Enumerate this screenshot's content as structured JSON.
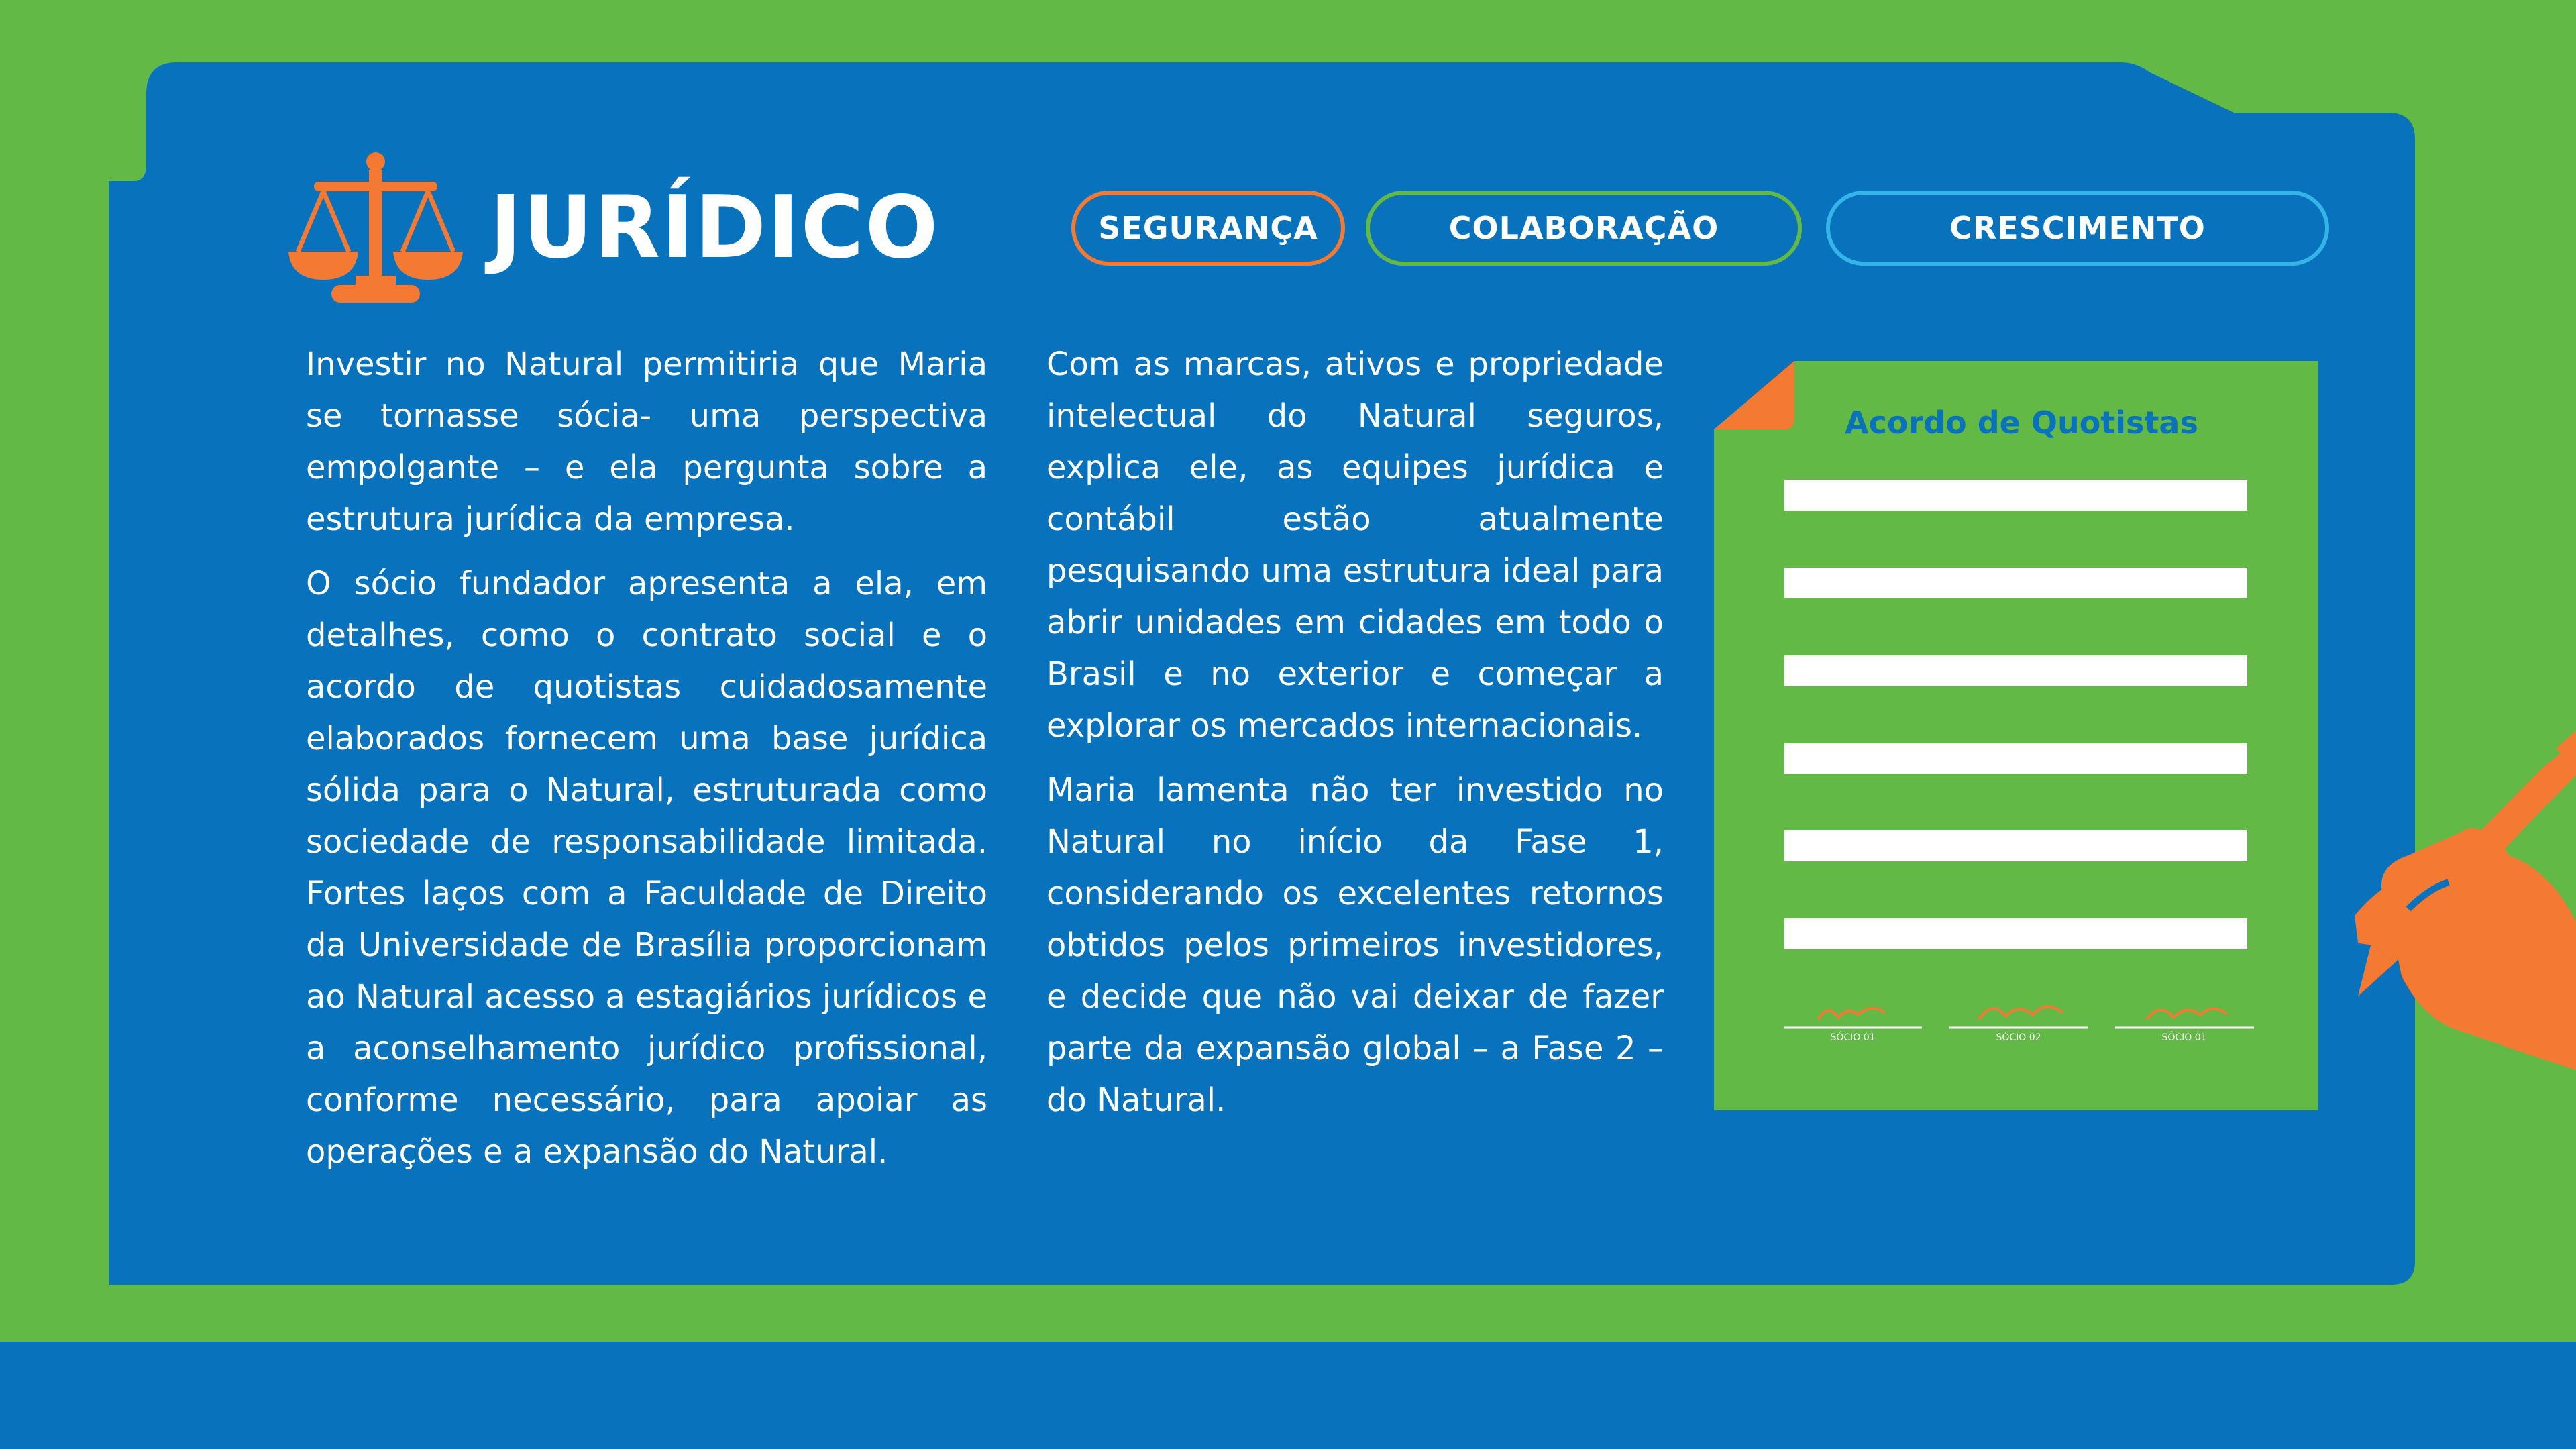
{
  "header": {
    "title": "JURÍDICO",
    "icon": "scale-icon"
  },
  "tabs": [
    {
      "label": "SEGURANÇA",
      "color": "#f47a34"
    },
    {
      "label": "COLABORAÇÃO",
      "color": "#62b946"
    },
    {
      "label": "CRESCIMENTO",
      "color": "#34b5e8"
    }
  ],
  "column1": {
    "p1": "Investir no Natural permitiria que Maria se tornasse sócia- uma perspectiva empolgante – e ela pergunta sobre a estrutura jurídica da empresa.",
    "p2": "O sócio fundador apresenta a ela, em detalhes, como o contrato social e o acordo de quotistas cuidadosamente elaborados fornecem uma base jurídica sólida para o Natural, estruturada como sociedade de responsabilidade limitada. Fortes laços com a Faculdade de Direito da Universidade de Brasília proporcionam ao Natural acesso a estagiários jurídicos e a aconselhamento jurídico profissional, conforme necessário, para apoiar as operações e a expansão do Natural."
  },
  "column2": {
    "p1": "Com as marcas, ativos e propriedade intelectual do Natural seguros, explica ele, as equipes jurídica e contábil estão atualmente pesquisando uma estrutura ideal para abrir unidades em cidades em todo o Brasil e no exterior e começar a explorar os mercados internacionais.",
    "p2": "Maria lamenta não ter investido no Natural no início da Fase 1, considerando os excelentes retornos obtidos pelos primeiros investidores, e decide que não vai deixar de fazer parte da expansão global – a Fase 2 – do Natural."
  },
  "document": {
    "title": "Acordo de Quotistas",
    "signatures": [
      "SÓCIO 01",
      "SÓCIO 02",
      "SÓCIO 01"
    ]
  },
  "colors": {
    "green": "#62b946",
    "blue": "#0872bc",
    "orange": "#f47a34",
    "light_blue": "#34b5e8",
    "white": "#ffffff"
  }
}
